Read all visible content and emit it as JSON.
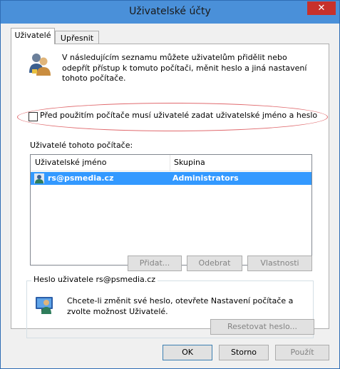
{
  "window": {
    "title": "Uživatelské účty",
    "close_glyph": "✕"
  },
  "tabs": [
    {
      "label": "Uživatelé",
      "active": true
    },
    {
      "label": "Upřesnit",
      "active": false
    }
  ],
  "intro": {
    "text": "V následujícím seznamu můžete uživatelům přidělit nebo odepřít přístup k tomuto počítači, měnit heslo a jiná nastavení tohoto počítače.",
    "icon": "users-icon"
  },
  "require_login": {
    "label": "Před použitím počítače musí uživatelé zadat uživatelské jméno a heslo",
    "checked": false
  },
  "users_section": {
    "label": "Uživatelé tohoto počítače:",
    "columns": [
      "Uživatelské jméno",
      "Skupina"
    ],
    "rows": [
      {
        "name": "rs@psmedia.cz",
        "group": "Administrators",
        "selected": true
      }
    ]
  },
  "list_buttons": {
    "add": "Přidat...",
    "remove": "Odebrat",
    "properties": "Vlastnosti"
  },
  "password_group": {
    "legend": "Heslo uživatele rs@psmedia.cz",
    "text": "Chcete-li změnit své heslo, otevřete Nastavení počítače a zvolte možnost Uživatelé.",
    "reset_button": "Resetovat heslo..."
  },
  "dialog_buttons": {
    "ok": "OK",
    "cancel": "Storno",
    "apply": "Použít"
  },
  "colors": {
    "accent": "#4a90d9",
    "selection": "#3399ff",
    "highlight_oval": "#e06a6e"
  }
}
